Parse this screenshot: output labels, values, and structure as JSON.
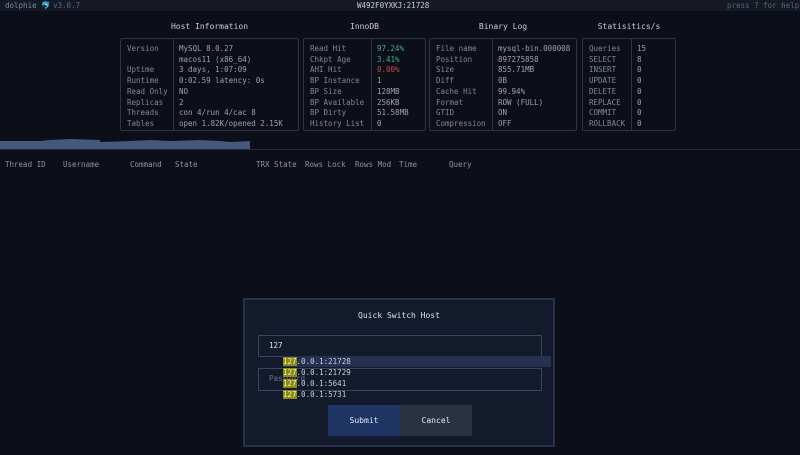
{
  "topbar": {
    "app": "dolphie",
    "version": "v3.0.7",
    "host": "W492F0YXKJ:21728",
    "help": "press ? for help"
  },
  "panels": [
    {
      "title": "Host Information",
      "rows": [
        [
          "Version",
          "MySQL 8.0.27"
        ],
        [
          "",
          "macos11 (x86_64)"
        ],
        [
          "Uptime",
          "3 days, 1:07:09"
        ],
        [
          "Runtime",
          "0:02.59 latency: 0s"
        ],
        [
          "Read Only",
          "NO"
        ],
        [
          "Replicas",
          "2"
        ],
        [
          "Threads",
          "con 4/run 4/cac 8"
        ],
        [
          "Tables",
          "open 1.82K/opened 2.15K"
        ]
      ]
    },
    {
      "title": "InnoDB",
      "rows": [
        [
          "Read Hit",
          "97.24%"
        ],
        [
          "Chkpt Age",
          "3.41%"
        ],
        [
          "AHI Hit",
          "0.00%"
        ],
        [
          "BP Instance",
          "1"
        ],
        [
          "BP Size",
          "128MB"
        ],
        [
          "BP Available",
          "256KB"
        ],
        [
          "BP Dirty",
          "51.58MB"
        ],
        [
          "History List",
          "0"
        ]
      ]
    },
    {
      "title": "Binary Log",
      "rows": [
        [
          "File name",
          "mysql-bin.000008"
        ],
        [
          "Position",
          "897275858"
        ],
        [
          "Size",
          "855.71MB"
        ],
        [
          "Diff",
          "0B"
        ],
        [
          "Cache Hit",
          "99.94%"
        ],
        [
          "Format",
          "ROW (FULL)"
        ],
        [
          "GTID",
          "ON"
        ],
        [
          "Compression",
          "OFF"
        ]
      ]
    },
    {
      "title": "Statisitics/s",
      "rows": [
        [
          "Queries",
          "15"
        ],
        [
          "SELECT",
          "8"
        ],
        [
          "INSERT",
          "0"
        ],
        [
          "UPDATE",
          "0"
        ],
        [
          "DELETE",
          "0"
        ],
        [
          "REPLACE",
          "0"
        ],
        [
          "COMMIT",
          "0"
        ],
        [
          "ROLLBACK",
          "0"
        ]
      ]
    }
  ],
  "colors": {
    "good": "#3fae8a",
    "bad": "#c24a4a",
    "highlight": "#8c8a16"
  },
  "columns": [
    "Thread ID",
    "Username",
    "Command",
    "State",
    "TRX State",
    "Rows Lock",
    "Rows Mod",
    "Time",
    "Query"
  ],
  "modal": {
    "title": "Quick Switch Host",
    "host_value": "127",
    "password_placeholder": "Password",
    "match": "127",
    "options": [
      ".0.0.1:21728",
      ".0.0.1:21729",
      ".0.0.1:5641",
      ".0.0.1:5731"
    ],
    "submit": "Submit",
    "cancel": "Cancel"
  }
}
